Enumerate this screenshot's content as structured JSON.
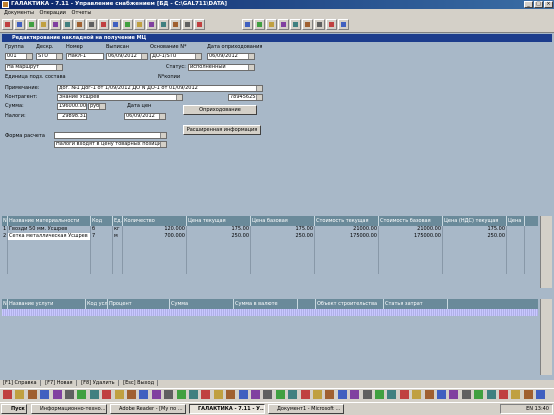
{
  "window": {
    "title": "ГАЛАКТИКА - 7.11 - Управление снабжением [БД - C:\\GAL711\\DATA]"
  },
  "menu": [
    "Документы",
    "Операции",
    "Отчеты"
  ],
  "form": {
    "title": "Редактирование накладной на получение МЦ",
    "labels": {
      "group": "Группа",
      "desc": "Дескр.",
      "number": "Номер",
      "issued": "Выписан",
      "basis": "Основание N*",
      "receipt_date": "Дата оприходования",
      "status": "Статус:",
      "unit": "Единица подз. состава",
      "n_copies": "N*копии",
      "note": "Примечание:",
      "contractor": "Контрагент:",
      "sum": "Сумма:",
      "tax": "Налоги:",
      "price_date": "Дата цен",
      "payment_form": "Форма расчета"
    },
    "values": {
      "group": "001",
      "desc": "STU",
      "number": "Накл-1",
      "issued": "06/09/2012",
      "basis": "ДО-1/STU",
      "receipt_date": "06/09/2012",
      "route": "На маршрут",
      "status": "исполненный",
      "note": "дог. №1 Дог-1 от 1/09/2012 ДО N ДО-1 от 01/09/2012",
      "contractor": "Знание Усшрев",
      "contractor_code": "7894562589",
      "sum": "196000.00",
      "currency": "руб",
      "tax": "29898.31",
      "price_date": "06/09/2012",
      "payment_form": "",
      "tax_note": "Налоги входят в цену товарных позиций"
    },
    "buttons": {
      "receive": "Оприходование",
      "extended": "Расширенная информация"
    }
  },
  "grid1": {
    "columns": [
      "N",
      "Название материальности",
      "Код",
      "Ед.",
      "Количество",
      "Цена текущая",
      "Цена базовая",
      "Стоимость текущая",
      "Стоимость базовая",
      "Цена (НДС) текущая",
      "Цена"
    ],
    "rows": [
      [
        "1",
        "Гвозди 50 мм. Усшрев",
        "б",
        "кг",
        "120.000",
        "175.00",
        "175.00",
        "21000.00",
        "21000.00",
        "175.00"
      ],
      [
        "2",
        "Сетка металлическая Усшрев",
        "7",
        "м",
        "700.000",
        "250.00",
        "250.00",
        "175000.00",
        "175000.00",
        "250.00"
      ]
    ]
  },
  "grid2": {
    "columns": [
      "N",
      "Название услуги",
      "Код услуги",
      "Процент",
      "Сумма",
      "Сумма в валюте",
      "",
      "Объект строительства",
      "Статья затрат"
    ]
  },
  "statusbar": [
    "[F1] Справка",
    "[F7] Новая",
    "[F8] Удалить",
    "[Esc] Выход"
  ],
  "taskbar": {
    "start": "Пуск",
    "items": [
      "Информационно-техно...",
      "Adobe Reader - [Му по ...",
      "ГАЛАКТИКА - 7.11 - У...",
      "Документ1 - Microsoft ..."
    ],
    "clock": "13:40",
    "lang": "EN"
  },
  "colors": {
    "title": "#0a246a",
    "panel": "#a8b8c8",
    "header": "#6a8a9a"
  }
}
